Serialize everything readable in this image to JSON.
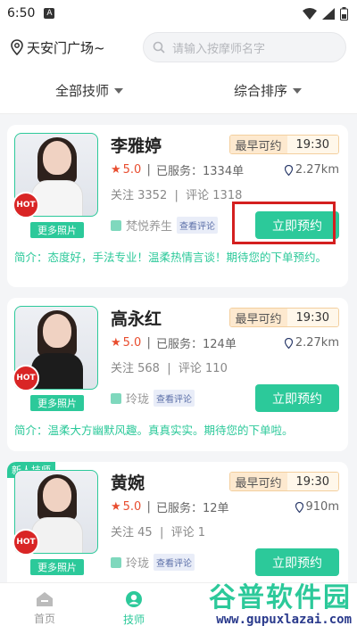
{
  "status_bar": {
    "time": "6:50",
    "notif_icon": "A"
  },
  "header": {
    "location": "天安门广场~",
    "search_placeholder": "请输入按摩师名字"
  },
  "filters": [
    {
      "label": "全部技师"
    },
    {
      "label": "综合排序"
    }
  ],
  "colors": {
    "accent": "#2cc99a",
    "highlight": "#d41f1f",
    "hot": "#d92525"
  },
  "therapists": [
    {
      "name": "李雅婷",
      "earliest_label": "最早可约",
      "earliest_time": "19:30",
      "rating": "5.0",
      "served": "已服务：1334单",
      "distance": "2.27km",
      "follow": "关注 3352",
      "comments": "评论 1318",
      "shop": "梵悦养生",
      "review_tag": "查看评论",
      "book_label": "立即预约",
      "more_photos": "更多照片",
      "hot": "HOT",
      "intro": "简介：态度好，手法专业！温柔热情言谈！期待您的下单预约。",
      "outfit": "#f5f5f5",
      "new_tag": ""
    },
    {
      "name": "高永红",
      "earliest_label": "最早可约",
      "earliest_time": "19:30",
      "rating": "5.0",
      "served": "已服务：124单",
      "distance": "2.27km",
      "follow": "关注 568",
      "comments": "评论 110",
      "shop": "玲珑",
      "review_tag": "查看评论",
      "book_label": "立即预约",
      "more_photos": "更多照片",
      "hot": "HOT",
      "intro": "简介：温柔大方幽默风趣。真真实实。期待您的下单啦。",
      "outfit": "#1c1c1c",
      "new_tag": ""
    },
    {
      "name": "黄婉",
      "earliest_label": "最早可约",
      "earliest_time": "19:30",
      "rating": "5.0",
      "served": "已服务：12单",
      "distance": "910m",
      "follow": "关注 45",
      "comments": "评论 1",
      "shop": "玲珑",
      "review_tag": "查看评论",
      "book_label": "立即预约",
      "more_photos": "更多照片",
      "hot": "HOT",
      "intro": "",
      "outfit": "#f2f2f2",
      "new_tag": "新人技师"
    }
  ],
  "tabbar": [
    {
      "label": "首页"
    },
    {
      "label": "技师"
    }
  ],
  "watermark": {
    "title": "谷普软件园",
    "url": "www.gupuxlazai.com"
  }
}
